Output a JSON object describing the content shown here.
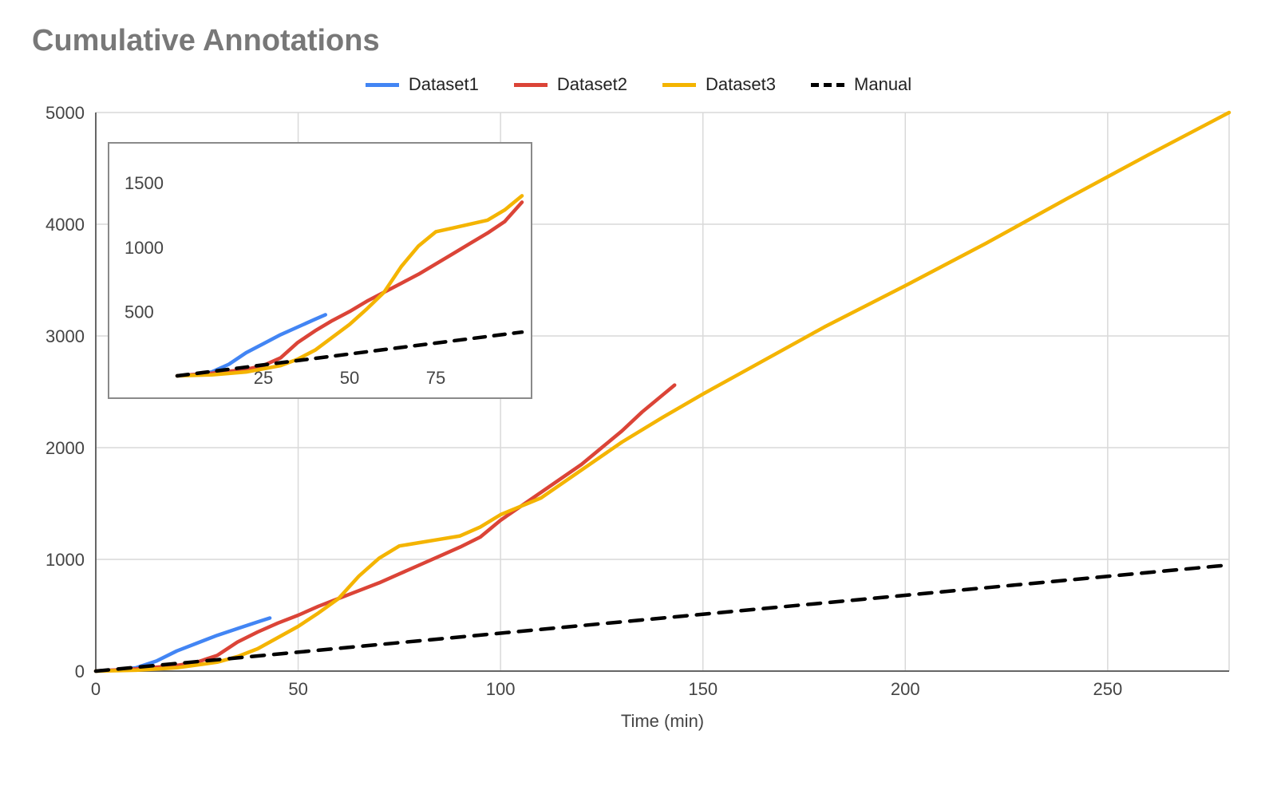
{
  "title": "Cumulative Annotations",
  "legend": {
    "dataset1": "Dataset1",
    "dataset2": "Dataset2",
    "dataset3": "Dataset3",
    "manual": "Manual"
  },
  "xlabel": "Time (min)",
  "colors": {
    "dataset1": "#4285F4",
    "dataset2": "#DB4437",
    "dataset3": "#F4B400",
    "manual": "#000000"
  },
  "chart_data": [
    {
      "type": "line",
      "title": "Cumulative Annotations",
      "xlabel": "Time (min)",
      "ylabel": "",
      "xlim": [
        0,
        280
      ],
      "ylim": [
        0,
        5000
      ],
      "xticks": [
        0,
        50,
        100,
        150,
        200,
        250
      ],
      "yticks": [
        0,
        1000,
        2000,
        3000,
        4000,
        5000
      ],
      "grid": true,
      "legend_position": "top",
      "series": [
        {
          "name": "Dataset1",
          "color": "#4285F4",
          "x": [
            0,
            5,
            10,
            15,
            20,
            25,
            30,
            35,
            40,
            43
          ],
          "y": [
            0,
            10,
            30,
            90,
            180,
            250,
            320,
            380,
            440,
            475
          ]
        },
        {
          "name": "Dataset2",
          "color": "#DB4437",
          "x": [
            0,
            10,
            20,
            25,
            30,
            35,
            40,
            45,
            50,
            55,
            60,
            65,
            70,
            75,
            80,
            85,
            90,
            95,
            100,
            110,
            120,
            125,
            130,
            135,
            140,
            143
          ],
          "y": [
            0,
            20,
            50,
            80,
            140,
            260,
            350,
            430,
            500,
            580,
            650,
            720,
            790,
            870,
            950,
            1030,
            1110,
            1200,
            1350,
            1600,
            1850,
            2000,
            2150,
            2320,
            2470,
            2560
          ]
        },
        {
          "name": "Dataset3",
          "color": "#F4B400",
          "x": [
            0,
            10,
            20,
            30,
            35,
            40,
            45,
            50,
            55,
            60,
            65,
            70,
            75,
            80,
            85,
            90,
            95,
            100,
            110,
            120,
            130,
            140,
            150,
            160,
            180,
            200,
            220,
            240,
            260,
            280
          ],
          "y": [
            0,
            8,
            30,
            80,
            130,
            200,
            300,
            400,
            520,
            650,
            850,
            1010,
            1120,
            1150,
            1180,
            1210,
            1290,
            1400,
            1550,
            1800,
            2050,
            2270,
            2480,
            2680,
            3080,
            3450,
            3830,
            4230,
            4620,
            5000
          ]
        },
        {
          "name": "Manual",
          "color": "#000000",
          "dashed": true,
          "x": [
            0,
            280
          ],
          "y": [
            0,
            950
          ]
        }
      ]
    },
    {
      "type": "line",
      "title": "inset",
      "is_inset_of": 0,
      "xlabel": "",
      "ylabel": "",
      "xlim": [
        0,
        100
      ],
      "ylim": [
        0,
        1700
      ],
      "xticks": [
        25,
        50,
        75
      ],
      "yticks": [
        500,
        1000,
        1500
      ],
      "grid": false,
      "series": [
        {
          "name": "Dataset1",
          "color": "#4285F4",
          "x": [
            0,
            5,
            10,
            15,
            20,
            25,
            30,
            35,
            40,
            43
          ],
          "y": [
            0,
            10,
            30,
            90,
            180,
            250,
            320,
            380,
            440,
            475
          ]
        },
        {
          "name": "Dataset2",
          "color": "#DB4437",
          "x": [
            0,
            10,
            20,
            25,
            30,
            35,
            40,
            45,
            50,
            55,
            60,
            65,
            70,
            75,
            80,
            85,
            90,
            95,
            100
          ],
          "y": [
            0,
            20,
            50,
            80,
            140,
            260,
            350,
            430,
            500,
            580,
            650,
            720,
            790,
            870,
            950,
            1030,
            1110,
            1200,
            1350
          ]
        },
        {
          "name": "Dataset3",
          "color": "#F4B400",
          "x": [
            0,
            10,
            20,
            30,
            35,
            40,
            45,
            50,
            55,
            60,
            65,
            70,
            75,
            80,
            85,
            90,
            95,
            100
          ],
          "y": [
            0,
            8,
            30,
            80,
            130,
            200,
            300,
            400,
            520,
            650,
            850,
            1010,
            1120,
            1150,
            1180,
            1210,
            1290,
            1400
          ]
        },
        {
          "name": "Manual",
          "color": "#000000",
          "dashed": true,
          "x": [
            0,
            100
          ],
          "y": [
            0,
            340
          ]
        }
      ]
    }
  ]
}
